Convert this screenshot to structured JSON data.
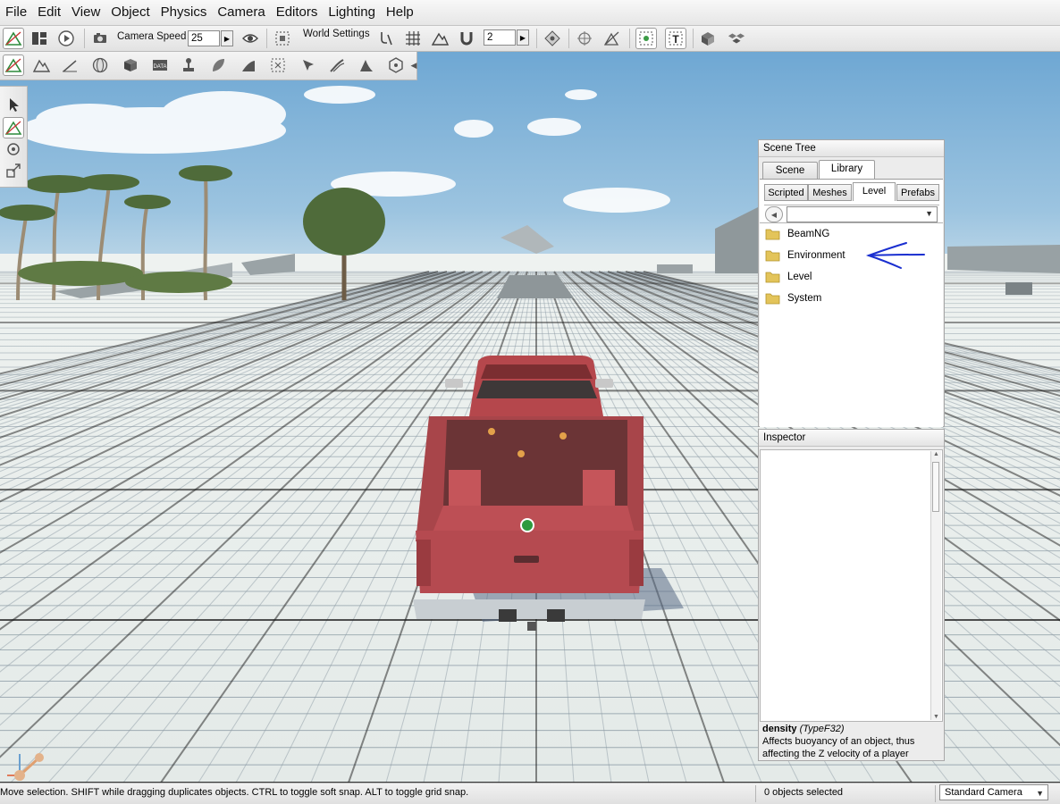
{
  "menu": [
    "File",
    "Edit",
    "View",
    "Object",
    "Physics",
    "Camera",
    "Editors",
    "Lighting",
    "Help"
  ],
  "toolbar": {
    "camera_speed_label": "Camera Speed",
    "camera_speed_value": "25",
    "world_settings_label": "World Settings",
    "snap_value": "2"
  },
  "scene_tree": {
    "title": "Scene Tree",
    "tabs": [
      "Scene",
      "Library"
    ],
    "subtabs": [
      "Scripted",
      "Meshes",
      "Level",
      "Prefabs"
    ],
    "folders": [
      "BeamNG",
      "Environment",
      "Level",
      "System"
    ]
  },
  "inspector": {
    "title": "Inspector",
    "field_name": "density",
    "field_type": "(TypeF32)",
    "description": "Affects buoyancy of an object, thus affecting the Z velocity of a player"
  },
  "statusbar": {
    "message": "Move selection.  SHIFT while dragging duplicates objects.  CTRL to toggle soft snap.  ALT to toggle grid snap.",
    "selection": "0 objects selected",
    "camera": "Standard Camera"
  },
  "colors": {
    "annotation_arrow": "#1a2fd0",
    "truck_body": "#b4474c",
    "folder": "#e3c45a",
    "sky": "#8dbbdc"
  }
}
